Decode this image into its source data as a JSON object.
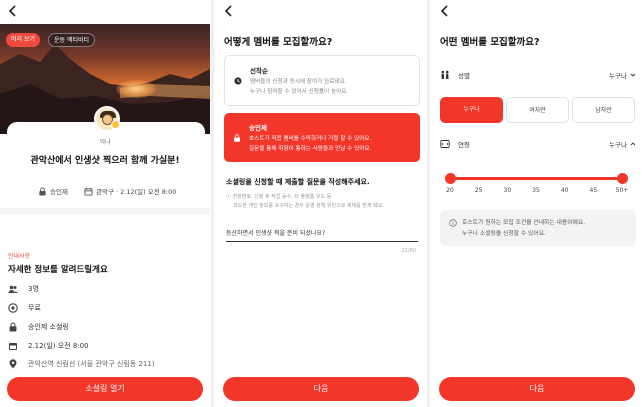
{
  "colors": {
    "accent": "#f2362a",
    "notice": "#f04a3e"
  },
  "screen1": {
    "chips": [
      "미리 보기",
      "운동 액티비티"
    ],
    "host_name": "익나",
    "event_title": "관악산에서 인생샷 찍으러 함께 가실분!",
    "meta_approval": "승인제",
    "meta_date": "관악구 · 2.12(일) 오전 8:00",
    "notice_label": "안내사항",
    "notice_title": "자세한 정보를 알려드릴게요",
    "info": [
      {
        "icon": "people-icon",
        "text": "3명"
      },
      {
        "icon": "coin-icon",
        "text": "무료"
      },
      {
        "icon": "lock-icon",
        "text": "승인제 소셜링"
      },
      {
        "icon": "calendar-icon",
        "text": "2.12(일) 오전 8:00"
      },
      {
        "icon": "location-pin-icon",
        "text": "관악산역 신림선 (서울 관악구 신림동 211)"
      }
    ],
    "cta": "소셜링 열기"
  },
  "screen2": {
    "title": "어떻게 멤버를 모집할까요?",
    "option1": {
      "title": "선착순",
      "desc1": "멤버들의 신청과 동시에 참여가 완료돼요.",
      "desc2": "누구나 참여할 수 있어서 신청률이 높아요."
    },
    "option2": {
      "title": "승인제",
      "desc1": "호스트가 직접 멤버를 수락하거나 거절 할 수 있어요.",
      "desc2": "질문을 통해 취향이 통하는 사람들과 만날 수 있어요."
    },
    "question_title": "소셜링을 신청할 때 제출할 질문을 작성해주세요.",
    "question_hint1": "전화번호, 신청 후 작업 등수, 타 플랫폼 유도 등",
    "question_hint2": "과도한 개인 정보를 요구하는 경우 운영 정책 위반으로 제재를 받게 돼요.",
    "question_value": "등산하면서 인생샷 찍을 준비 되셨나요?",
    "counter": "21/80",
    "cta": "다음"
  },
  "screen3": {
    "title": "어떤 멤버를 모집할까요?",
    "gender_label": "성별",
    "gender_value": "누구나",
    "gender_options": [
      "누구나",
      "여자만",
      "남자만"
    ],
    "age_label": "연령",
    "age_value": "누구나",
    "age_ticks": [
      "20",
      "25",
      "30",
      "35",
      "40",
      "45",
      "50+"
    ],
    "age_range": [
      20,
      50
    ],
    "info1": "호스트가 원하는 모집 조건을 안내하는 내용이에요.",
    "info2": "누구나 소셜링을 신청할 수 있어요.",
    "cta": "다음"
  }
}
